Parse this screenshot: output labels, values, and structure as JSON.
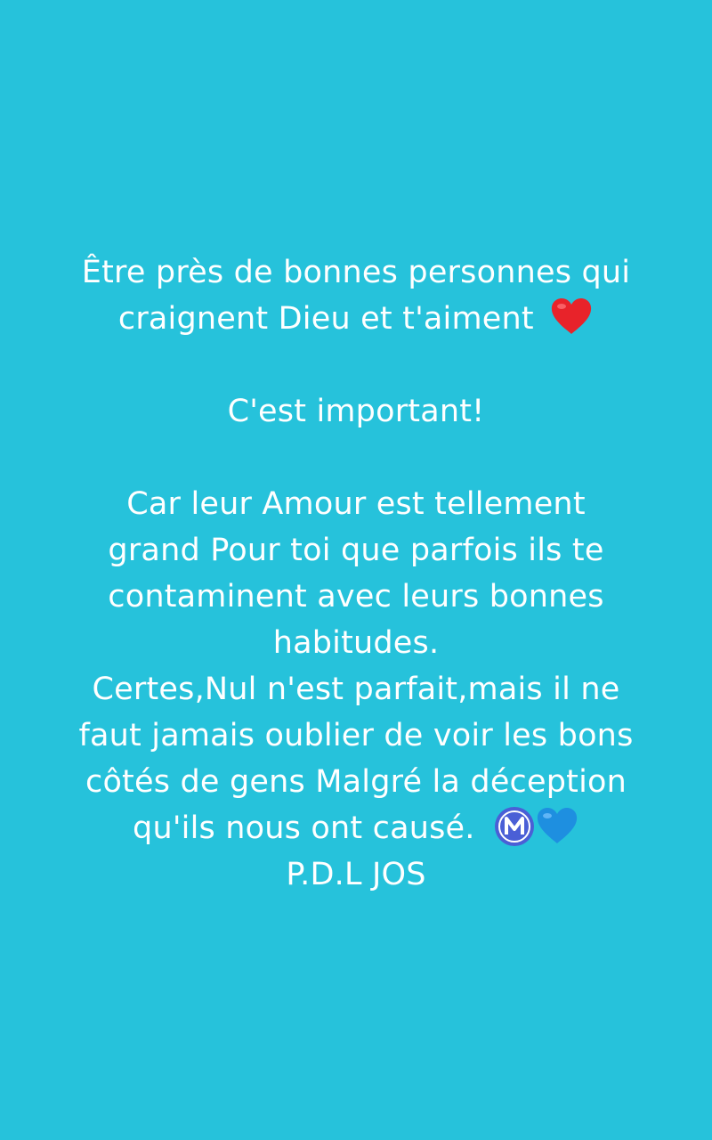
{
  "story": {
    "background_color": "#26c2db",
    "text_color": "#ffffff",
    "lines": [
      "Être près de bonnes personnes qui",
      "craignent Dieu et t'aiment",
      "C'est important!",
      "Car leur Amour est tellement",
      "grand Pour toi que parfois ils te",
      "contaminent avec leurs bonnes",
      "habitudes.",
      "Certes,Nul n'est parfait,mais il ne",
      "faut jamais oublier de voir les bons",
      "côtés de gens Malgré la déception",
      "qu'ils nous ont  causé.",
      "P.D.L JOS"
    ],
    "icons": {
      "red_heart": "red-heart-icon",
      "circled_m": "circled-m-icon",
      "blue_heart": "blue-heart-icon"
    },
    "icon_colors": {
      "red_heart": "#e8232a",
      "circled_m": "#4a5fd6",
      "blue_heart": "#1e8fe0"
    }
  }
}
